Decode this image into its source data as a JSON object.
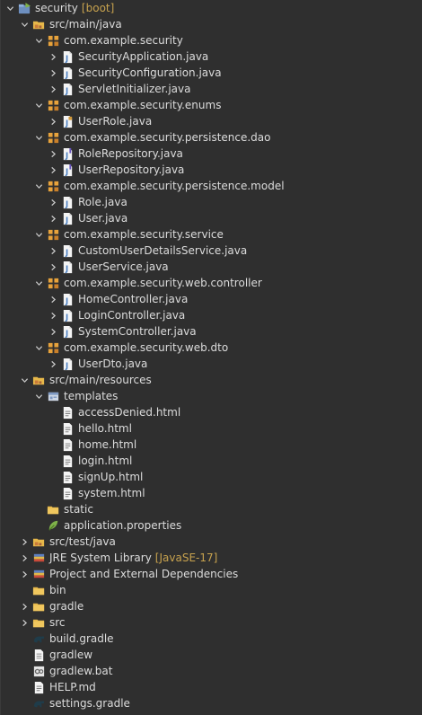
{
  "tree": [
    {
      "label": "security",
      "decor": "[boot]",
      "indent": 0,
      "twisty": "expanded",
      "icon": "project-icon"
    },
    {
      "label": "src/main/java",
      "indent": 1,
      "twisty": "expanded",
      "icon": "source-folder-icon"
    },
    {
      "label": "com.example.security",
      "indent": 2,
      "twisty": "expanded",
      "icon": "package-icon"
    },
    {
      "label": "SecurityApplication.java",
      "indent": 3,
      "twisty": "collapsed",
      "icon": "java-file-icon"
    },
    {
      "label": "SecurityConfiguration.java",
      "indent": 3,
      "twisty": "collapsed",
      "icon": "java-file-icon"
    },
    {
      "label": "ServletInitializer.java",
      "indent": 3,
      "twisty": "collapsed",
      "icon": "java-file-icon"
    },
    {
      "label": "com.example.security.enums",
      "indent": 2,
      "twisty": "expanded",
      "icon": "package-icon"
    },
    {
      "label": "UserRole.java",
      "indent": 3,
      "twisty": "collapsed",
      "icon": "java-enum-file-icon"
    },
    {
      "label": "com.example.security.persistence.dao",
      "indent": 2,
      "twisty": "expanded",
      "icon": "package-icon"
    },
    {
      "label": "RoleRepository.java",
      "indent": 3,
      "twisty": "collapsed",
      "icon": "java-interface-file-icon"
    },
    {
      "label": "UserRepository.java",
      "indent": 3,
      "twisty": "collapsed",
      "icon": "java-interface-file-icon"
    },
    {
      "label": "com.example.security.persistence.model",
      "indent": 2,
      "twisty": "expanded",
      "icon": "package-icon"
    },
    {
      "label": "Role.java",
      "indent": 3,
      "twisty": "collapsed",
      "icon": "java-file-icon"
    },
    {
      "label": "User.java",
      "indent": 3,
      "twisty": "collapsed",
      "icon": "java-file-icon"
    },
    {
      "label": "com.example.security.service",
      "indent": 2,
      "twisty": "expanded",
      "icon": "package-icon"
    },
    {
      "label": "CustomUserDetailsService.java",
      "indent": 3,
      "twisty": "collapsed",
      "icon": "java-file-icon"
    },
    {
      "label": "UserService.java",
      "indent": 3,
      "twisty": "collapsed",
      "icon": "java-file-icon"
    },
    {
      "label": "com.example.security.web.controller",
      "indent": 2,
      "twisty": "expanded",
      "icon": "package-icon"
    },
    {
      "label": "HomeController.java",
      "indent": 3,
      "twisty": "collapsed",
      "icon": "java-file-icon"
    },
    {
      "label": "LoginController.java",
      "indent": 3,
      "twisty": "collapsed",
      "icon": "java-file-icon"
    },
    {
      "label": "SystemController.java",
      "indent": 3,
      "twisty": "collapsed",
      "icon": "java-file-icon"
    },
    {
      "label": "com.example.security.web.dto",
      "indent": 2,
      "twisty": "expanded",
      "icon": "package-icon"
    },
    {
      "label": "UserDto.java",
      "indent": 3,
      "twisty": "collapsed",
      "icon": "java-file-icon"
    },
    {
      "label": "src/main/resources",
      "indent": 1,
      "twisty": "expanded",
      "icon": "source-folder-icon"
    },
    {
      "label": "templates",
      "indent": 2,
      "twisty": "expanded",
      "icon": "templates-folder-icon"
    },
    {
      "label": "accessDenied.html",
      "indent": 3,
      "twisty": "none",
      "icon": "html-file-icon"
    },
    {
      "label": "hello.html",
      "indent": 3,
      "twisty": "none",
      "icon": "html-file-icon"
    },
    {
      "label": "home.html",
      "indent": 3,
      "twisty": "none",
      "icon": "html-file-icon"
    },
    {
      "label": "login.html",
      "indent": 3,
      "twisty": "none",
      "icon": "html-file-icon"
    },
    {
      "label": "signUp.html",
      "indent": 3,
      "twisty": "none",
      "icon": "html-file-icon"
    },
    {
      "label": "system.html",
      "indent": 3,
      "twisty": "none",
      "icon": "html-file-icon"
    },
    {
      "label": "static",
      "indent": 2,
      "twisty": "none",
      "icon": "folder-icon"
    },
    {
      "label": "application.properties",
      "indent": 2,
      "twisty": "none",
      "icon": "properties-file-icon"
    },
    {
      "label": "src/test/java",
      "indent": 1,
      "twisty": "collapsed",
      "icon": "source-folder-icon"
    },
    {
      "label": "JRE System Library",
      "decor": "[JavaSE-17]",
      "indent": 1,
      "twisty": "collapsed",
      "icon": "library-icon"
    },
    {
      "label": "Project and External Dependencies",
      "indent": 1,
      "twisty": "collapsed",
      "icon": "library-icon"
    },
    {
      "label": "bin",
      "indent": 1,
      "twisty": "none",
      "icon": "folder-icon"
    },
    {
      "label": "gradle",
      "indent": 1,
      "twisty": "collapsed",
      "icon": "folder-icon"
    },
    {
      "label": "src",
      "indent": 1,
      "twisty": "collapsed",
      "icon": "folder-icon"
    },
    {
      "label": "build.gradle",
      "indent": 1,
      "twisty": "none",
      "icon": "gradle-file-icon"
    },
    {
      "label": "gradlew",
      "indent": 1,
      "twisty": "none",
      "icon": "text-file-icon"
    },
    {
      "label": "gradlew.bat",
      "indent": 1,
      "twisty": "none",
      "icon": "bat-file-icon"
    },
    {
      "label": "HELP.md",
      "indent": 1,
      "twisty": "none",
      "icon": "markdown-file-icon"
    },
    {
      "label": "settings.gradle",
      "indent": 1,
      "twisty": "none",
      "icon": "gradle-file-icon"
    }
  ],
  "colors": {
    "background": "#2f2f2f",
    "text": "#dcdcdc",
    "decoration": "#c7a24e",
    "package": "#e8a33c",
    "java": "#4a7fc1",
    "folder": "#e7b84a"
  }
}
